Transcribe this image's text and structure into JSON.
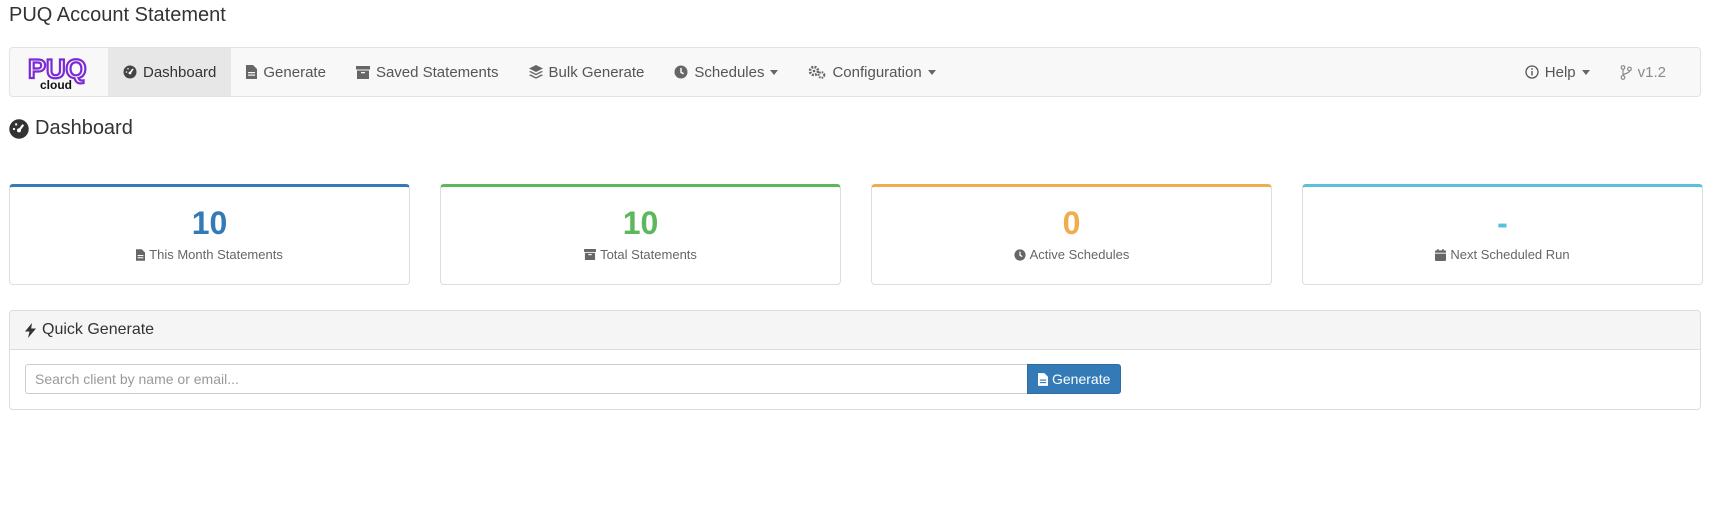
{
  "app": {
    "title": "PUQ Account Statement"
  },
  "logo": {
    "text_top": "PUQ",
    "text_bottom": "cloud",
    "color": "#7a2ad6"
  },
  "nav": {
    "dashboard": "Dashboard",
    "generate": "Generate",
    "saved_statements": "Saved Statements",
    "bulk_generate": "Bulk Generate",
    "schedules": "Schedules",
    "configuration": "Configuration",
    "help": "Help",
    "version": "v1.2"
  },
  "page": {
    "heading": "Dashboard"
  },
  "stats": [
    {
      "value": "10",
      "label": "This Month Statements",
      "color": "#337ab7",
      "icon": "file-icon"
    },
    {
      "value": "10",
      "label": "Total Statements",
      "color": "#5cb85c",
      "icon": "archive-icon"
    },
    {
      "value": "0",
      "label": "Active Schedules",
      "color": "#f0ad4e",
      "icon": "clock-icon"
    },
    {
      "value": "-",
      "label": "Next Scheduled Run",
      "color": "#5bc0de",
      "icon": "calendar-icon"
    }
  ],
  "quick_generate": {
    "title": "Quick Generate",
    "search_placeholder": "Search client by name or email...",
    "button_label": "Generate"
  }
}
